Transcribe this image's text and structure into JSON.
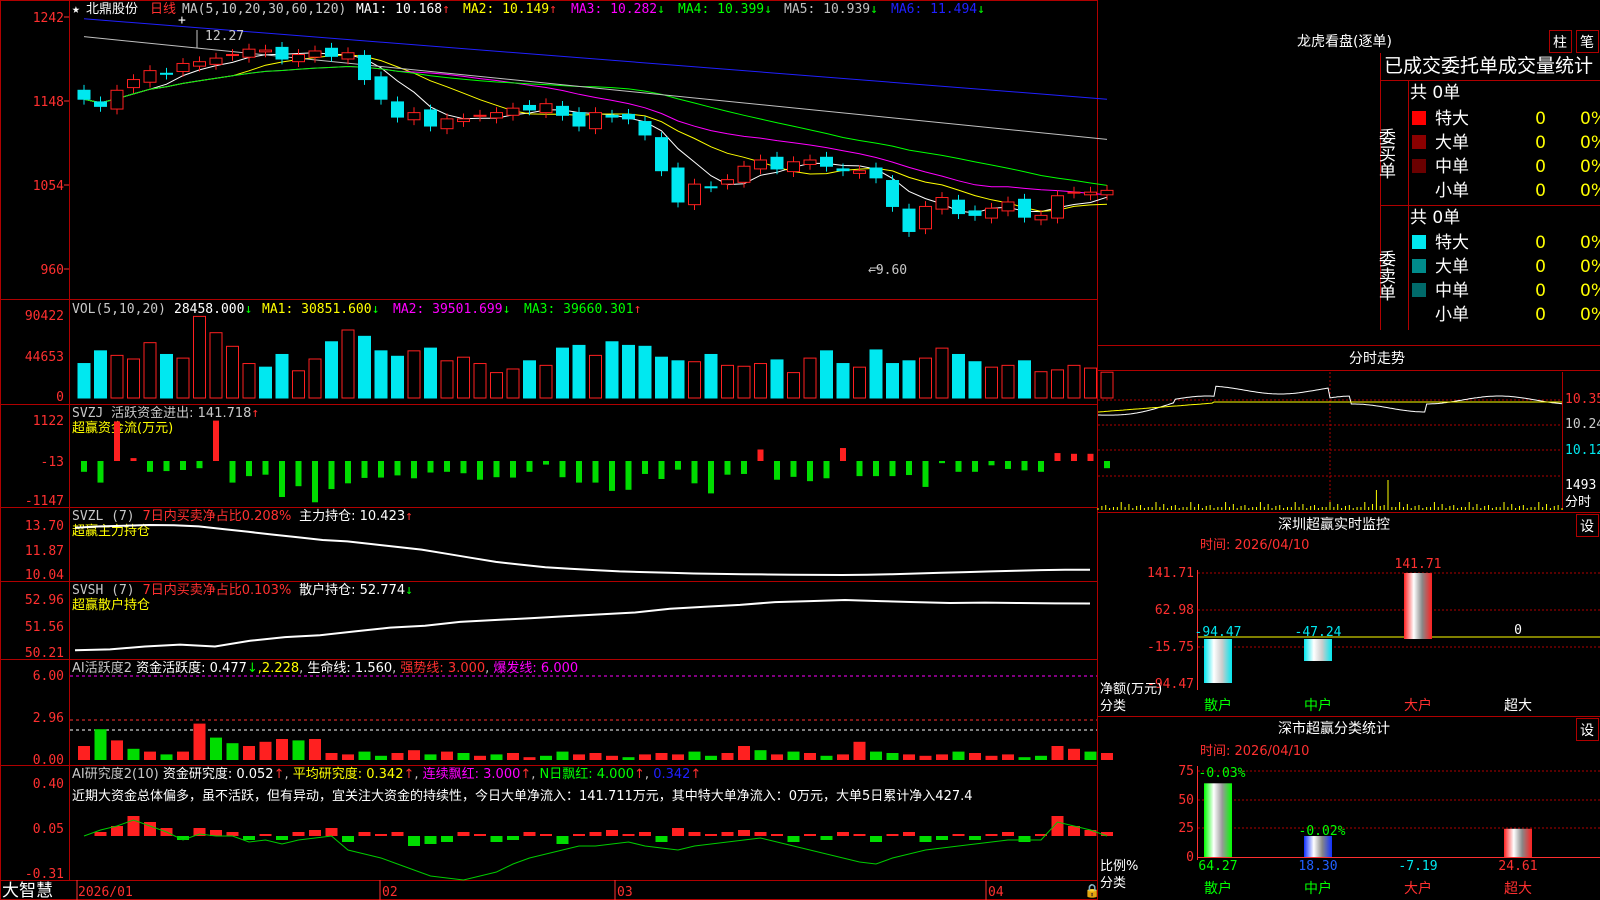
{
  "colors": {
    "up": "#ff2020",
    "down": "#00e8f0",
    "frame": "#b00000",
    "text": "#c8c8c8",
    "ma1": "#ffffff",
    "ma2": "#ffff00",
    "ma3": "#ff00ff",
    "ma4": "#00ff00",
    "ma5": "#c0c0c0",
    "ma6": "#2020ff"
  },
  "main": {
    "star": "★",
    "name": "北鼎股份",
    "period": "日线",
    "ma_label": "MA(5,10,20,30,60,120)",
    "ma": [
      {
        "label": "MA1:",
        "value": "10.168",
        "arrow": "↑"
      },
      {
        "label": "MA2:",
        "value": "10.149",
        "arrow": "↑"
      },
      {
        "label": "MA3:",
        "value": "10.282",
        "arrow": "↓"
      },
      {
        "label": "MA4:",
        "value": "10.399",
        "arrow": "↓"
      },
      {
        "label": "MA5:",
        "value": "10.939",
        "arrow": "↓"
      },
      {
        "label": "MA6:",
        "value": "11.494",
        "arrow": "↓"
      }
    ],
    "yticks": [
      "1242",
      "1148",
      "1054",
      "960"
    ],
    "hi_mark": "12.27",
    "lo_mark": "9.60"
  },
  "vol": {
    "title": "VOL(5,10,20)",
    "value": "28458.000",
    "arrow": "↓",
    "ma1": "MA1: 30851.600",
    "ma1a": "↓",
    "ma2": "MA2: 39501.699",
    "ma2a": "↓",
    "ma3": "MA3: 39660.301",
    "ma3a": "↑",
    "yticks": [
      "90422",
      "44653",
      "0"
    ]
  },
  "svzj": {
    "title": "SVZJ",
    "label": "活跃资金进出: 141.718",
    "arrow": "↑",
    "sub": "超赢资金流(万元)",
    "yticks": [
      "1122",
      "-13",
      "-1147"
    ]
  },
  "svzl": {
    "title": "SVZL (7)",
    "label": "7日内买卖净占比0.208%",
    "label2": "主力持仓: 10.423",
    "arrow": "↑",
    "sub": "超赢主力持仓",
    "yticks": [
      "13.70",
      "11.87",
      "10.04"
    ]
  },
  "svsh": {
    "title": "SVSH (7)",
    "label": "7日内买卖净占比0.103%",
    "label2": "散户持仓: 52.774",
    "arrow": "↓",
    "sub": "超赢散户持仓",
    "yticks": [
      "52.96",
      "51.56",
      "50.21"
    ]
  },
  "ai1": {
    "title": "AI活跃度2",
    "l1": "资金活跃度: 0.477",
    "a1": "↓",
    "l2": "2.228",
    "l3": "生命线: 1.560",
    "l4": "强势线: 3.000",
    "l5": "爆发线: 6.000",
    "yticks": [
      "6.00",
      "2.96",
      "0.00"
    ]
  },
  "ai2": {
    "title": "AI研究度2(10)",
    "l1": "资金研究度: 0.052",
    "a1": "↑",
    "l2": "平均研究度: 0.342",
    "a2": "↑",
    "l3": "连续飘红: 3.000",
    "a3": "↑",
    "l4": "N日飘红: 4.000",
    "a4": "↑",
    "l5": "0.342",
    "a5": "↑",
    "note": "近期大资金总体偏多，虽不活跃，但有异动，宜关注大资金的持续性，今日大单净流入：141.711万元，其中特大单净流入：0万元，大单5日累计净入427.4",
    "yticks": [
      "0.40",
      "0.05",
      "-0.31"
    ]
  },
  "xaxis": {
    "labels": [
      "2026/01",
      "02",
      "03",
      "04"
    ],
    "brand": "大智慧"
  },
  "right": {
    "lhkp_title": "龙虎看盘(逐单)",
    "btn_zhu": "柱",
    "btn_bi": "笔",
    "stats_title": "已成交委托单成交量统计",
    "buy": {
      "side": "委买单",
      "total": "共 0单",
      "rows": [
        {
          "label": "特大",
          "count": "0",
          "pct": "0%"
        },
        {
          "label": "大单",
          "count": "0",
          "pct": "0%"
        },
        {
          "label": "中单",
          "count": "0",
          "pct": "0%"
        },
        {
          "label": "小单",
          "count": "0",
          "pct": "0%"
        }
      ]
    },
    "sell": {
      "side": "委卖单",
      "total": "共 0单",
      "rows": [
        {
          "label": "特大",
          "count": "0",
          "pct": "0%"
        },
        {
          "label": "大单",
          "count": "0",
          "pct": "0%"
        },
        {
          "label": "中单",
          "count": "0",
          "pct": "0%"
        },
        {
          "label": "小单",
          "count": "0",
          "pct": "0%"
        }
      ]
    },
    "fenshi_title": "分时走势",
    "fenshi_prices": [
      "10.35",
      "10.24",
      "10.12"
    ],
    "fenshi_vol": "1493",
    "fenshi_label": "分时",
    "monitor_title": "深圳超赢实时监控",
    "monitor_btn": "设",
    "monitor_time": "时间: 2026/04/10",
    "monitor_yticks": [
      "141.71",
      "62.98",
      "-15.75",
      "-94.47"
    ],
    "monitor_ylabel": "净额(万元)",
    "monitor_xlabel": "分类",
    "classify_title": "深市超赢分类统计",
    "classify_btn": "设",
    "classify_time": "时间: 2026/04/10",
    "classify_yticks": [
      "75",
      "50",
      "25",
      "0"
    ],
    "classify_ylabel": "比例%",
    "classify_xlabel": "分类"
  },
  "chart_data": [
    {
      "type": "bar",
      "title": "深圳超赢实时监控",
      "categories": [
        "散户",
        "中户",
        "大户",
        "超大"
      ],
      "values": [
        -94.47,
        -47.24,
        141.71,
        0
      ],
      "ylabel": "净额(万元)",
      "ylim": [
        -94.47,
        141.71
      ]
    },
    {
      "type": "bar",
      "title": "深市超赢分类统计",
      "categories": [
        "散户",
        "中户",
        "大户",
        "超大"
      ],
      "series": [
        {
          "values": [
            64.27,
            18.3,
            -7.19,
            24.61
          ]
        },
        {
          "values": [
            -0.03,
            -0.02,
            null,
            null
          ]
        }
      ],
      "ylabel": "比例%",
      "ylim": [
        0,
        75
      ]
    },
    {
      "type": "bar",
      "title": "VOL(5,10,20)",
      "values": [
        38000,
        52000,
        47000,
        43000,
        61000,
        48000,
        44000,
        90000,
        72000,
        57000,
        38000,
        34000,
        48000,
        30000,
        43000,
        62000,
        75000,
        68000,
        52000,
        46000,
        52000,
        55000,
        41000,
        45000,
        38000,
        28000,
        32000,
        41000,
        36000,
        55000,
        58000,
        47000,
        62000,
        58000,
        57000,
        45000,
        41000,
        40000,
        48000,
        36000,
        35000,
        38000,
        42000,
        28000,
        44000,
        52000,
        38000,
        34000,
        53000,
        38000,
        41000,
        44000,
        55000,
        48000,
        40000,
        34000,
        36000,
        41000,
        29000,
        31000,
        36000,
        33000,
        28458
      ]
    },
    {
      "type": "bar",
      "title": "SVZJ 超赢资金流(万元)",
      "values": [
        -300,
        -600,
        1100,
        80,
        -300,
        -280,
        -250,
        -200,
        1122,
        -600,
        -420,
        -380,
        -1000,
        -700,
        -1147,
        -780,
        -620,
        -470,
        -460,
        -400,
        -480,
        -320,
        -300,
        -340,
        -520,
        -450,
        -460,
        -300,
        -100,
        -450,
        -600,
        -600,
        -830,
        -800,
        -360,
        -500,
        -240,
        -620,
        -900,
        -380,
        -360,
        320,
        -520,
        -440,
        -560,
        -480,
        360,
        -420,
        -420,
        -420,
        -390,
        -720,
        -60,
        -300,
        -300,
        -120,
        -220,
        -260,
        -300,
        220,
        200,
        200,
        -200
      ],
      "ylim": [
        -1147,
        1122
      ]
    },
    {
      "type": "line",
      "title": "SVZL 超赢主力持仓",
      "values": [
        13.5,
        13.6,
        13.65,
        13.7,
        13.68,
        13.6,
        13.4,
        13.2,
        13.0,
        12.8,
        12.6,
        12.5,
        12.3,
        12.1,
        11.9,
        11.6,
        11.3,
        11.0,
        10.8,
        10.6,
        10.5,
        10.4,
        10.3,
        10.25,
        10.2,
        10.15,
        10.12,
        10.1,
        10.08,
        10.06,
        10.05,
        10.04,
        10.06,
        10.1,
        10.15,
        10.2,
        10.25,
        10.3,
        10.35,
        10.4,
        10.42,
        10.423
      ],
      "ylim": [
        10.04,
        13.7
      ]
    },
    {
      "type": "line",
      "title": "SVSH 超赢散户持仓",
      "values": [
        50.3,
        50.35,
        50.5,
        50.6,
        50.5,
        50.8,
        51.0,
        51.1,
        51.3,
        51.5,
        51.6,
        51.8,
        51.9,
        52.0,
        52.1,
        52.2,
        52.3,
        52.5,
        52.6,
        52.7,
        52.85,
        52.9,
        52.96,
        52.9,
        52.85,
        52.8,
        52.82,
        52.8,
        52.78,
        52.774
      ],
      "ylim": [
        50.21,
        52.96
      ]
    }
  ]
}
